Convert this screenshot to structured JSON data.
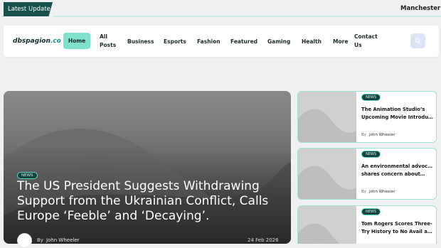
{
  "ticker": {
    "badge": "Latest Update",
    "text": "Manchester L"
  },
  "header": {
    "logo": "dbspagion",
    "logo_suffix": ".co",
    "nav": [
      {
        "label": "Home",
        "active": true
      },
      {
        "label": "All\nPosts"
      },
      {
        "label": "Business"
      },
      {
        "label": "Esports"
      },
      {
        "label": "Fashion"
      },
      {
        "label": "Featured"
      },
      {
        "label": "Gaming"
      },
      {
        "label": "Health"
      },
      {
        "label": "More"
      },
      {
        "label": "Contact\nUs"
      }
    ]
  },
  "hero": {
    "badge": "NEWS",
    "title": "The US President Suggests Withdrawing Support from the Ukrainian Conflict, Calls Europe ‘Feeble’ and ‘Decaying’.",
    "by": "By",
    "author": "John Wheeler",
    "date": "24 Feb 2026"
  },
  "cards": [
    {
      "badge": "NEWS",
      "title_l1": "The Animation Studio’s",
      "title_l2": "Upcoming Movie Introduce…",
      "by": "By",
      "author": "John Wheeler"
    },
    {
      "badge": "NEWS",
      "title_l1": "An environmental advocate",
      "title_l2": "shares concern about…",
      "by": "By",
      "author": "John Wheeler"
    },
    {
      "badge": "NEWS",
      "title_l1": "Tom Rogers Scores Three-",
      "title_l2": "Try History to No Avail as A…",
      "by": "",
      "author": ""
    }
  ],
  "colors": {
    "accent": "#17504c",
    "nav_active": "#7fe0cc",
    "card_border": "#9fe3d5"
  }
}
